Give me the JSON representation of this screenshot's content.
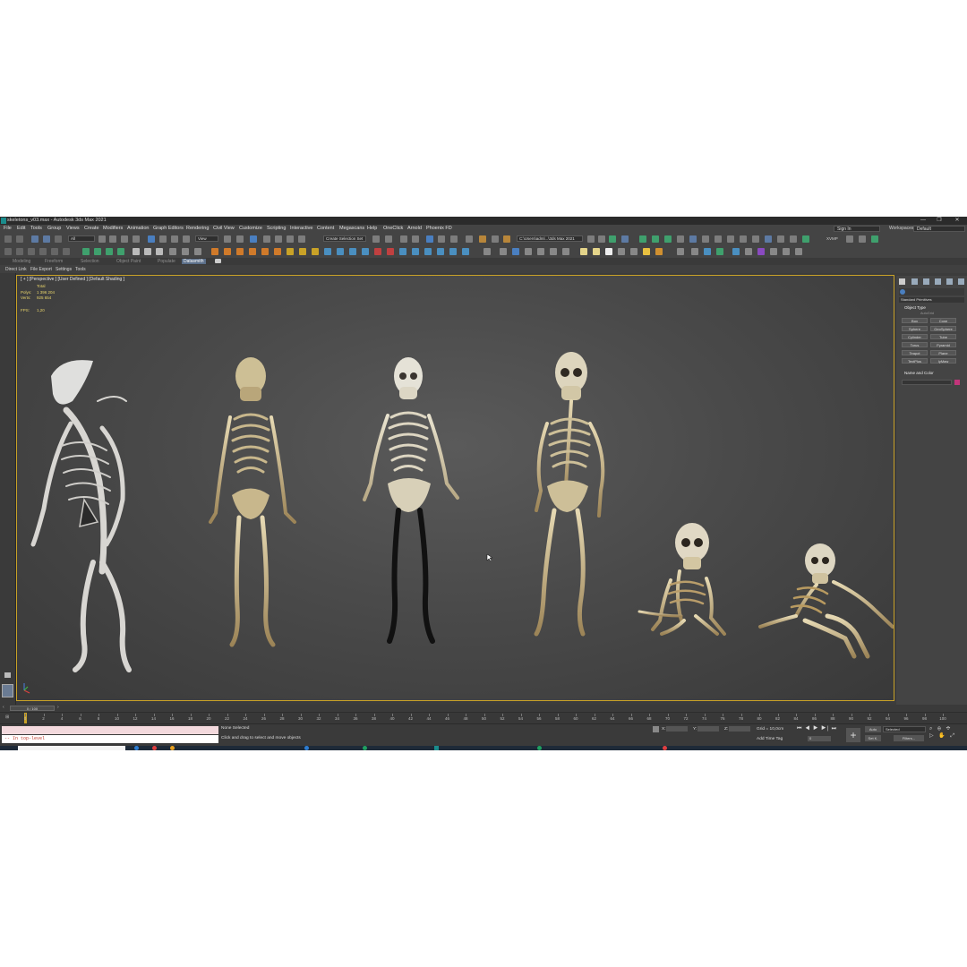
{
  "window": {
    "title": "skeletons_v03.max - Autodesk 3ds Max 2021",
    "minimize": "—",
    "maximize": "❐",
    "close": "✕"
  },
  "menubar": {
    "items": [
      "File",
      "Edit",
      "Tools",
      "Group",
      "Views",
      "Create",
      "Modifiers",
      "Animation",
      "Graph Editors",
      "Rendering",
      "Civil View",
      "Customize",
      "Scripting",
      "Interactive",
      "Content",
      "Megascans",
      "Help",
      "OneClick",
      "Arnold",
      "Phoenix FD"
    ],
    "signin": "Sign In",
    "workspaces_label": "Workspaces:",
    "workspaces_value": "Default"
  },
  "toolbar": {
    "filter_all": "All",
    "view": "View",
    "selection_set": "Create Selection Set",
    "path": "C:\\Users\\adml...\\3ds Max 2021",
    "xvmp": "XVMP"
  },
  "ribbon": {
    "tabs": [
      "Modeling",
      "Freeform",
      "Selection",
      "Object Paint",
      "Populate",
      "Datasmith"
    ],
    "active_tab": "Datasmith",
    "sub_items": [
      "Direct Link",
      "File Export",
      "Settings",
      "Tools"
    ]
  },
  "viewport": {
    "label": "[ + ] [Perspective ] [User Defined ] [Default Shading ]",
    "total_label": "Total",
    "polys_label": "Polys:",
    "polys_value": "1 396 204",
    "verts_label": "Verts:",
    "verts_value": "925 654",
    "fps_label": "FPS:",
    "fps_value": "1,20"
  },
  "command_panel": {
    "dropdown": "Standard Primitives",
    "object_type_header": "Object Type",
    "autogrid": "AutoGrid",
    "buttons": [
      "Box",
      "Cone",
      "Sphere",
      "GeoSphere",
      "Cylinder",
      "Tube",
      "Torus",
      "Pyramid",
      "Teapot",
      "Plane",
      "TextPlus",
      "IyMaw"
    ],
    "name_color_header": "Name and Color",
    "color": "#c2357a"
  },
  "timeline": {
    "frame_counter": "0 / 100",
    "ticks": [
      0,
      2,
      4,
      6,
      8,
      10,
      12,
      14,
      16,
      18,
      20,
      22,
      24,
      26,
      28,
      30,
      32,
      34,
      36,
      38,
      40,
      42,
      44,
      46,
      48,
      50,
      52,
      54,
      56,
      58,
      60,
      62,
      64,
      66,
      68,
      70,
      72,
      74,
      76,
      78,
      80,
      82,
      84,
      86,
      88,
      90,
      92,
      94,
      96,
      98,
      100
    ]
  },
  "status": {
    "maxscript_output": "-- In top-level",
    "selection": "None Selected",
    "prompt": "Click and drag to select and move objects",
    "x_label": "X:",
    "y_label": "Y:",
    "z_label": "Z:",
    "grid": "Grid = 10,0cm",
    "add_time_tag": "Add Time Tag",
    "auto": "Auto",
    "selected": "Selected",
    "set_k": "Set K.",
    "filters": "Filters...",
    "frame_value": "0"
  },
  "colors": {
    "viewport_border": "#c9a227",
    "stats_text": "#e8d46a",
    "active_tab": "#5b6f8a",
    "maxscript_error": "#c0392b"
  }
}
